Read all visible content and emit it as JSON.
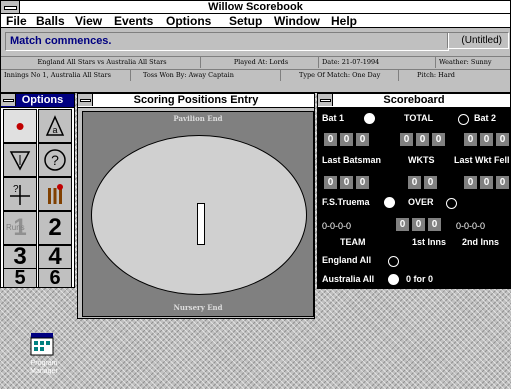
{
  "app": {
    "title": "Willow Scorebook",
    "menus": [
      "File",
      "Balls",
      "View",
      "Events",
      "Options",
      "Setup",
      "Window",
      "Help"
    ]
  },
  "status": {
    "message": "Match commences.",
    "document": "(Untitled)"
  },
  "match_info": {
    "teams": "England All Stars vs Australia All Stars",
    "venue": "Played At: Lords",
    "date": "Date: 21-07-1994",
    "weather": "Weather: Sunny",
    "innings": "Innings No 1, Australia All Stars",
    "toss": "Toss Won By: Away Captain",
    "match_type": "Type Of Match: One Day",
    "pitch": "Pitch: Hard"
  },
  "options_window": {
    "title": "Options",
    "tools": [
      {
        "name": "dot-ball-tool",
        "glyph": "•"
      },
      {
        "name": "appeal-tool",
        "glyph": "⚠"
      },
      {
        "name": "wide-tool",
        "glyph": "▽"
      },
      {
        "name": "query-tool",
        "glyph": "?"
      },
      {
        "name": "runs-adjust-tool",
        "glyph": "+"
      },
      {
        "name": "wicket-tool",
        "glyph": "Ш"
      },
      {
        "name": "runs-1-tool",
        "glyph": "1"
      },
      {
        "name": "runs-2-tool",
        "glyph": "2"
      },
      {
        "name": "runs-3-tool",
        "glyph": "3"
      },
      {
        "name": "runs-4-tool",
        "glyph": "4"
      },
      {
        "name": "runs-5-tool",
        "glyph": "5"
      },
      {
        "name": "runs-6-tool",
        "glyph": "6"
      }
    ],
    "runs_overlay": "Runs"
  },
  "scoring_window": {
    "title": "Scoring Positions Entry",
    "top_end": "Pavilion End",
    "bottom_end": "Nursery End"
  },
  "scoreboard": {
    "title": "Scoreboard",
    "bat1_label": "Bat 1",
    "total_label": "TOTAL",
    "bat2_label": "Bat 2",
    "bat1_digits": [
      "0",
      "0",
      "0"
    ],
    "total_digits": [
      "0",
      "0",
      "0"
    ],
    "bat2_digits": [
      "0",
      "0",
      "0"
    ],
    "last_batsman_label": "Last Batsman",
    "wkts_label": "WKTS",
    "last_wkt_label": "Last Wkt Fell",
    "last_batsman_digits": [
      "0",
      "0",
      "0"
    ],
    "wkts_digits": [
      "0",
      "0"
    ],
    "last_wkt_digits": [
      "0",
      "0",
      "0"
    ],
    "bowler_name": "F.S.Truema",
    "over_label": "OVER",
    "bowler_figures": "0-0-0-0",
    "over_digits": [
      "0",
      "0",
      "0"
    ],
    "other_bowler_figures": "0-0-0-0",
    "team_label": "TEAM",
    "first_inns_label": "1st Inns",
    "second_inns_label": "2nd Inns",
    "team1": "England All",
    "team2": "Australia All",
    "team2_score": "0 for 0"
  },
  "desktop": {
    "icon_label": "Program Manager"
  },
  "colors": {
    "active_title": "#000080",
    "desktop": "#c0c0c0",
    "scoreboard_bg": "#000000",
    "digit_bg": "#808080"
  }
}
